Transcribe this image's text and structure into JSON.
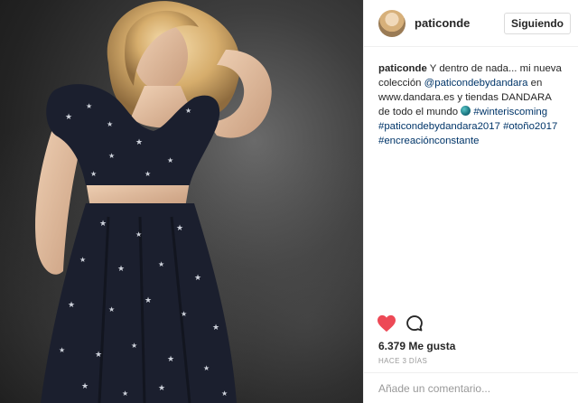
{
  "post": {
    "username": "paticonde",
    "follow_label": "Siguiendo",
    "caption": {
      "username": "paticonde",
      "text_1": "Y dentro de nada... mi nueva colección",
      "mention": "@paticondebydandara",
      "text_2": "en www.dandara.es y tiendas DANDARA de todo el mundo",
      "globe_icon": "globe-emoji",
      "tags": [
        "#winteriscoming",
        "#paticondebydandara2017",
        "#otoño2017",
        "#encreaciónconstante"
      ]
    },
    "icons": {
      "like": "heart-icon",
      "comment": "comment-icon"
    },
    "like_color": "#ed4956",
    "likes": "6.379 Me gusta",
    "time": "HACE 3 DÍAS",
    "comment_placeholder": "Añade un comentario..."
  }
}
